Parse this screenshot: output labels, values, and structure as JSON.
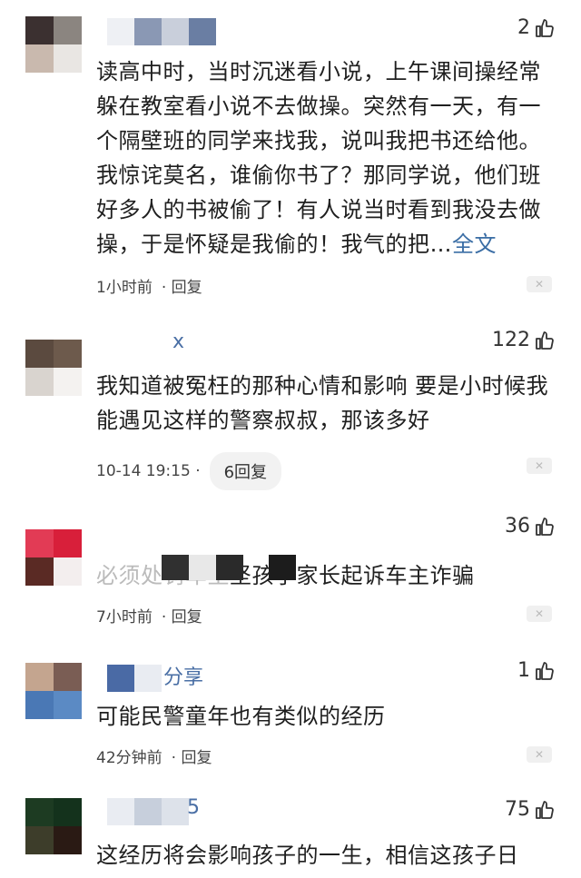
{
  "comments": [
    {
      "likes": "2",
      "body": "读高中时，当时沉迷看小说，上午课间操经常躲在教室看小说不去做操。突然有一天，有一个隔壁班的同学来找我，说叫我把书还给他。我惊诧莫名，谁偷你书了？那同学说，他们班好多人的书被偷了！有人说当时看到我没去做操，于是怀疑是我偷的！我气的把…",
      "full_link": "全文",
      "time": "1小时前",
      "reply": "· 回复",
      "name_suffix": "",
      "colors": [
        "#3b3030",
        "#8b8580",
        "#c9b9ae",
        "#e9e6e3"
      ]
    },
    {
      "likes": "122",
      "body": "我知道被冤枉的那种心情和影响 要是小时候我能遇见这样的警察叔叔，那该多好",
      "time": "10-14 19:15 ·",
      "reply_count": "6回复",
      "name_suffix": "x",
      "colors": [
        "#5b4a3f",
        "#6d5a4c",
        "#d9d4cf",
        "#f4f2f0"
      ]
    },
    {
      "likes": "36",
      "body": "坚孩子家长起诉车主诈骗",
      "body_prefix": "必须处罚车主",
      "time": "7小时前",
      "reply": "· 回复",
      "name_suffix": "",
      "colors": [
        "#e23b55",
        "#d81f3a",
        "#5a2a24",
        "#f3eeee"
      ]
    },
    {
      "likes": "1",
      "body": "可能民警童年也有类似的经历",
      "time": "42分钟前",
      "reply": "· 回复",
      "name_suffix": "分享",
      "colors": [
        "#c4a58f",
        "#7a5d54",
        "#4a78b5",
        "#5b8ac4"
      ]
    },
    {
      "likes": "75",
      "body": "这经历将会影响孩子的一生，相信这孩子日",
      "name_suffix": "5",
      "colors": [
        "#1d3b22",
        "#14321c",
        "#3d3d2a",
        "#2a1a14"
      ]
    }
  ],
  "icons": {
    "like": "thumbs-up-icon",
    "close": "close-icon"
  }
}
